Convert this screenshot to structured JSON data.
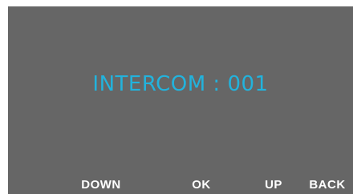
{
  "display": {
    "title": "INTERCOM : 001",
    "background_color": "#666666",
    "text_color": "#22b3dd"
  },
  "softkeys": {
    "down": "DOWN",
    "ok": "OK",
    "up": "UP",
    "back": "BACK"
  }
}
